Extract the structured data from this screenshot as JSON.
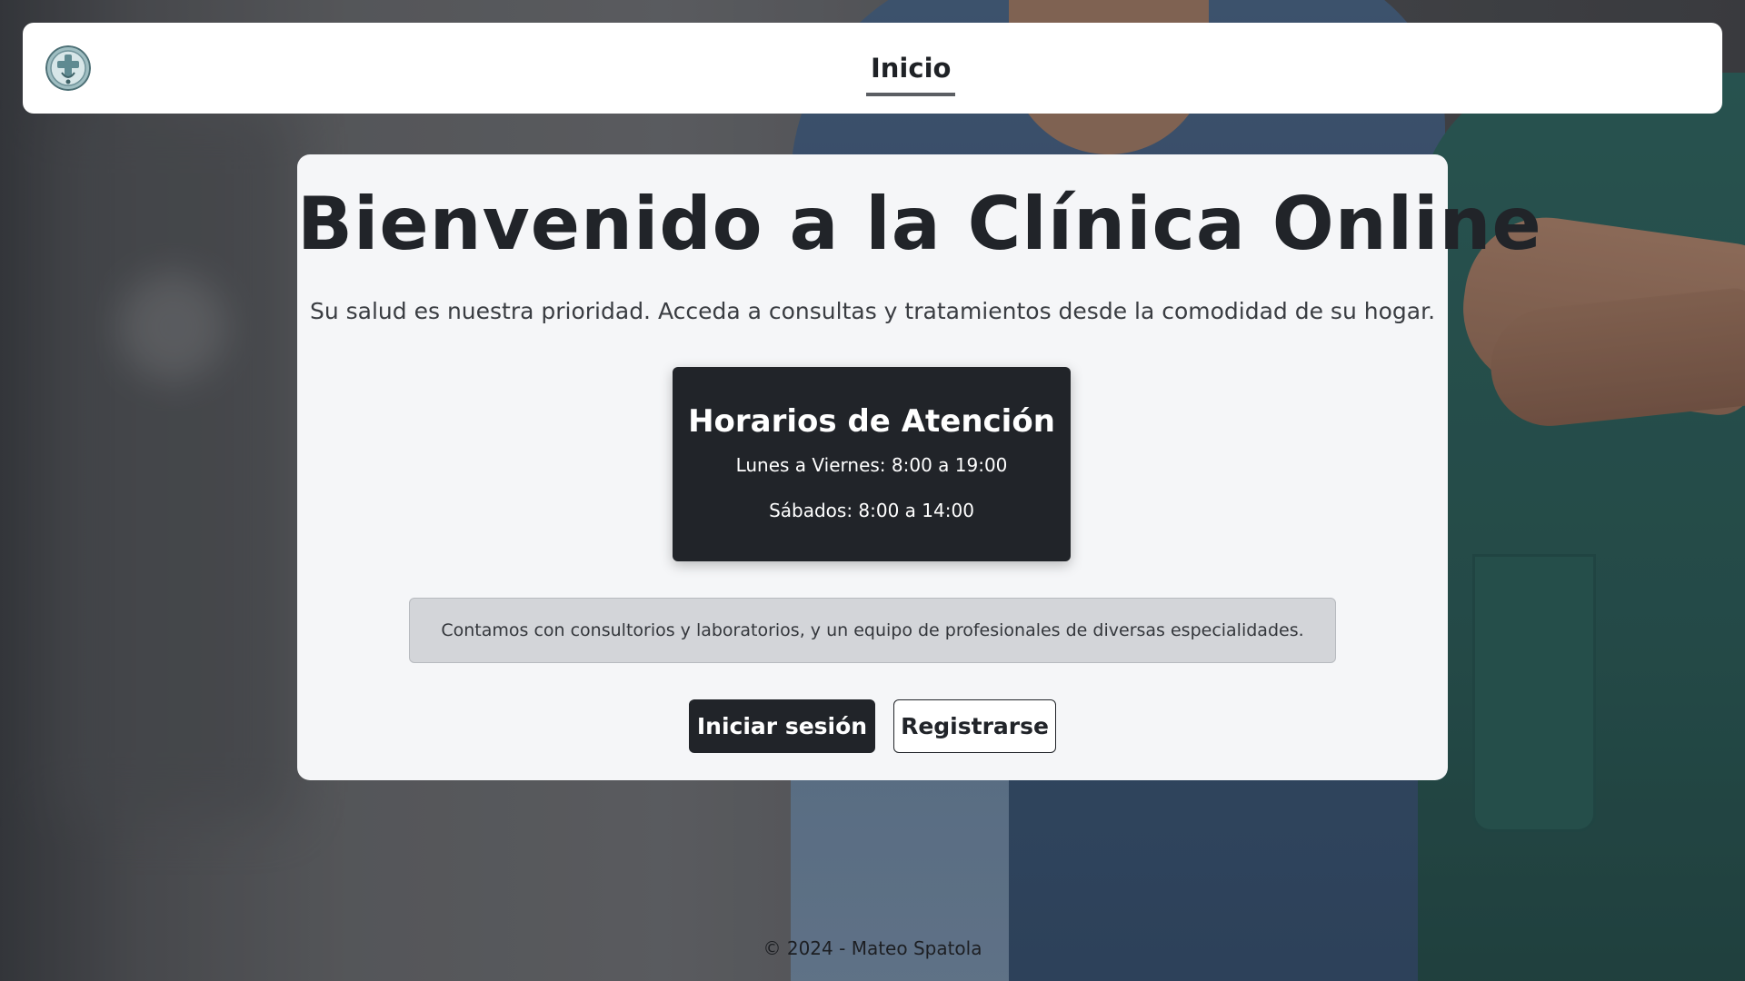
{
  "navbar": {
    "logo_icon": "clinic-logo-icon",
    "links": [
      {
        "label": "Inicio",
        "active": true
      }
    ]
  },
  "hero": {
    "title": "Bienvenido a la Clínica Online",
    "subtitle": "Su salud es nuestra prioridad. Acceda a consultas y tratamientos desde la comodidad de su hogar."
  },
  "hours": {
    "title": "Horarios de Atención",
    "weekdays": "Lunes a Viernes: 8:00 a 19:00",
    "saturday": "Sábados: 8:00 a 14:00"
  },
  "info": {
    "text": "Contamos con consultorios y laboratorios, y un equipo de profesionales de diversas especialidades."
  },
  "actions": {
    "login_label": "Iniciar sesión",
    "register_label": "Registrarse"
  },
  "footer": {
    "text": "© 2024 - Mateo Spatola"
  },
  "colors": {
    "primary_dark": "#212429",
    "card_background": "#f5f6f8",
    "info_background": "#d3d5d9",
    "navbar_background": "#ffffff"
  }
}
